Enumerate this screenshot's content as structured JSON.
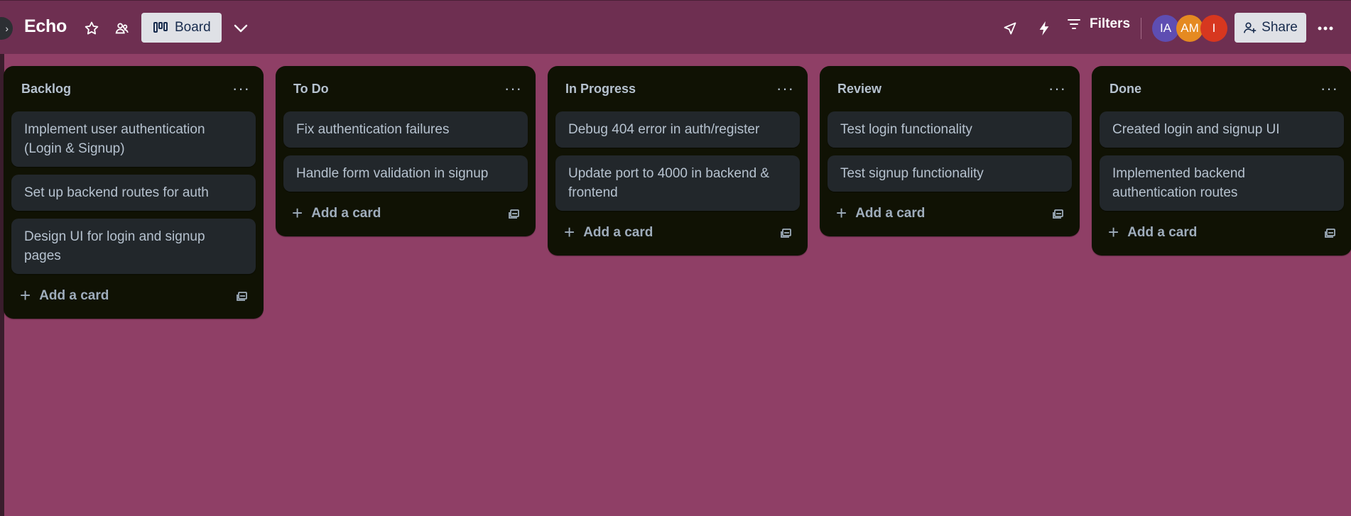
{
  "header": {
    "board_title": "Echo",
    "view_label": "Board",
    "filters_label": "Filters",
    "share_label": "Share",
    "icons": [
      "star-icon",
      "workspace-visibility-icon",
      "board-view-icon",
      "chevron-down-icon",
      "power-ups-icon",
      "automation-icon",
      "filter-icon",
      "share-icon",
      "more-icon"
    ],
    "members": [
      {
        "initials": "IA",
        "color": "#5e4db2"
      },
      {
        "initials": "AM",
        "color": "#e58a21"
      },
      {
        "initials": "I",
        "color": "#d7371f"
      }
    ]
  },
  "lists": [
    {
      "title": "Backlog",
      "cards": [
        "Implement user authentication (Login & Signup)",
        "Set up backend routes for auth",
        "Design UI for login and signup pages"
      ],
      "add_label": "Add a card"
    },
    {
      "title": "To Do",
      "cards": [
        "Fix authentication failures",
        "Handle form validation in signup"
      ],
      "add_label": "Add a card"
    },
    {
      "title": "In Progress",
      "cards": [
        "Debug 404 error in auth/register",
        "Update port to 4000 in backend & frontend"
      ],
      "add_label": "Add a card"
    },
    {
      "title": "Review",
      "cards": [
        "Test login functionality",
        "Test signup functionality"
      ],
      "add_label": "Add a card"
    },
    {
      "title": "Done",
      "cards": [
        "Created login and signup UI",
        "Implemented backend authentication routes"
      ],
      "add_label": "Add a card"
    }
  ],
  "colors": {
    "board_background": "#8f3f66",
    "header_background": "#6e2f51",
    "list_background": "#101204",
    "card_background": "#22272b"
  }
}
